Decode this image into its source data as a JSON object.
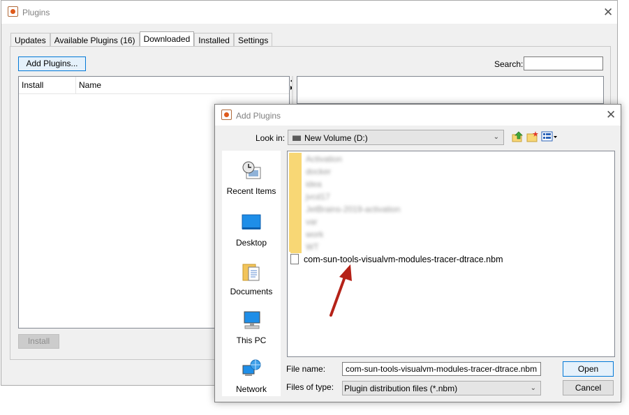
{
  "plugins_window": {
    "title": "Plugins",
    "tabs": [
      {
        "label": "Updates",
        "active": false
      },
      {
        "label": "Available Plugins (16)",
        "active": false
      },
      {
        "label": "Downloaded",
        "active": true
      },
      {
        "label": "Installed",
        "active": false
      },
      {
        "label": "Settings",
        "active": false
      }
    ],
    "add_plugins_label": "Add Plugins...",
    "search_label": "Search:",
    "search_value": "",
    "table": {
      "columns": [
        "Install",
        "Name"
      ],
      "rows": []
    },
    "install_label": "Install"
  },
  "dialog": {
    "title": "Add Plugins",
    "look_in_label": "Look in:",
    "look_in_value": "New Volume (D:)",
    "places": [
      {
        "label": "Recent Items",
        "icon": "recent-items-icon"
      },
      {
        "label": "Desktop",
        "icon": "desktop-icon"
      },
      {
        "label": "Documents",
        "icon": "documents-icon"
      },
      {
        "label": "This PC",
        "icon": "this-pc-icon"
      },
      {
        "label": "Network",
        "icon": "network-icon"
      }
    ],
    "folders": [
      "Activation",
      "docker",
      "idea",
      "jvcd17",
      "JetBrains-2019-activation",
      "var",
      "work",
      "WT"
    ],
    "file_name_item": "com-sun-tools-visualvm-modules-tracer-dtrace.nbm",
    "file_name_label": "File name:",
    "file_name_value": "com-sun-tools-visualvm-modules-tracer-dtrace.nbm",
    "files_of_type_label": "Files of type:",
    "files_of_type_value": "Plugin distribution files (*.nbm)",
    "open_label": "Open",
    "cancel_label": "Cancel"
  },
  "colors": {
    "annotation_arrow": "#b52218",
    "focus_border": "#0078d7",
    "folder": "#f8d775"
  }
}
